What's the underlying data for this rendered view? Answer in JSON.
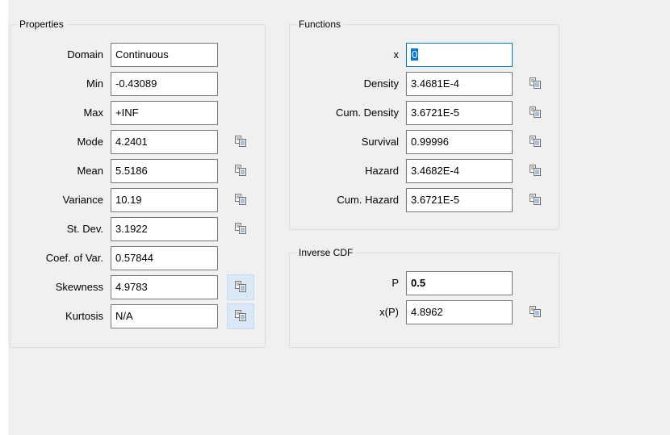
{
  "properties": {
    "title": "Properties",
    "rows": [
      {
        "label": "Domain",
        "value": "Continuous"
      },
      {
        "label": "Min",
        "value": "-0.43089"
      },
      {
        "label": "Max",
        "value": "+INF"
      },
      {
        "label": "Mode",
        "value": "4.2401",
        "copy": true
      },
      {
        "label": "Mean",
        "value": "5.5186",
        "copy": true
      },
      {
        "label": "Variance",
        "value": "10.19",
        "copy": true
      },
      {
        "label": "St. Dev.",
        "value": "3.1922",
        "copy": true
      },
      {
        "label": "Coef. of Var.",
        "value": "0.57844"
      },
      {
        "label": "Skewness",
        "value": "4.9783",
        "copy": true,
        "highlighted": true
      },
      {
        "label": "Kurtosis",
        "value": "N/A",
        "copy": true,
        "highlighted": true
      }
    ]
  },
  "functions": {
    "title": "Functions",
    "rows": [
      {
        "label": "x",
        "value": "0",
        "focused": true
      },
      {
        "label": "Density",
        "value": "3.4681E-4",
        "copy": true
      },
      {
        "label": "Cum. Density",
        "value": "3.6721E-5",
        "copy": true
      },
      {
        "label": "Survival",
        "value": "0.99996",
        "copy": true
      },
      {
        "label": "Hazard",
        "value": "3.4682E-4",
        "copy": true
      },
      {
        "label": "Cum. Hazard",
        "value": "3.6721E-5",
        "copy": true
      }
    ]
  },
  "inverse_cdf": {
    "title": "Inverse CDF",
    "rows": [
      {
        "label": "P",
        "value": "0.5",
        "bold": true
      },
      {
        "label": "x(P)",
        "value": "4.8962",
        "copy": true
      }
    ]
  },
  "icons": {
    "copy": "copy-icon"
  },
  "colors": {
    "background": "#f0f0f0",
    "focus": "#0078d7",
    "button_highlight": "#dbe9f7"
  }
}
